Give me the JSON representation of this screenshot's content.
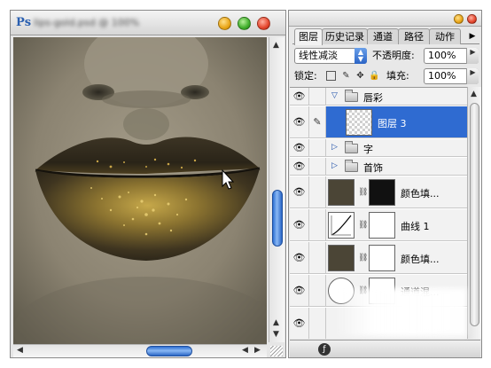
{
  "document_window": {
    "title_blurred": "lips-gold.psd @ 100%",
    "buttons": [
      "minimize",
      "zoom",
      "close"
    ]
  },
  "layers_palette": {
    "tabs": [
      "图层",
      "历史记录",
      "通道",
      "路径",
      "动作"
    ],
    "active_tab": "图层",
    "blend_mode": "线性减淡",
    "opacity_label": "不透明度:",
    "opacity_value": "100%",
    "lock_label": "锁定:",
    "fill_label": "填充:",
    "fill_value": "100%",
    "layers": [
      {
        "name": "唇彩",
        "kind": "group",
        "expanded": true,
        "visible": true
      },
      {
        "name": "图层 3",
        "kind": "pixel",
        "selected": true,
        "visible": true,
        "brush": true
      },
      {
        "name": "字",
        "kind": "group",
        "expanded": false,
        "visible": true
      },
      {
        "name": "首饰",
        "kind": "group",
        "expanded": false,
        "visible": true
      },
      {
        "name": "颜色填...",
        "kind": "fill",
        "visible": true
      },
      {
        "name": "曲线 1",
        "kind": "curves",
        "visible": true
      },
      {
        "name": "颜色填...",
        "kind": "fill",
        "visible": true
      },
      {
        "name": "通道混...",
        "kind": "channel-mixer",
        "visible": true
      },
      {
        "name": "",
        "kind": "background",
        "visible": true
      }
    ]
  },
  "colors": {
    "selection": "#2f6bd1",
    "scroll_thumb": "#2d6fd3",
    "fill_swatch": "#4b4536",
    "lip_gold": "#b3963b"
  },
  "icons": {
    "eye": "eye-icon",
    "brush": "brush-icon",
    "folder": "folder-icon",
    "chain": "link-icon"
  }
}
